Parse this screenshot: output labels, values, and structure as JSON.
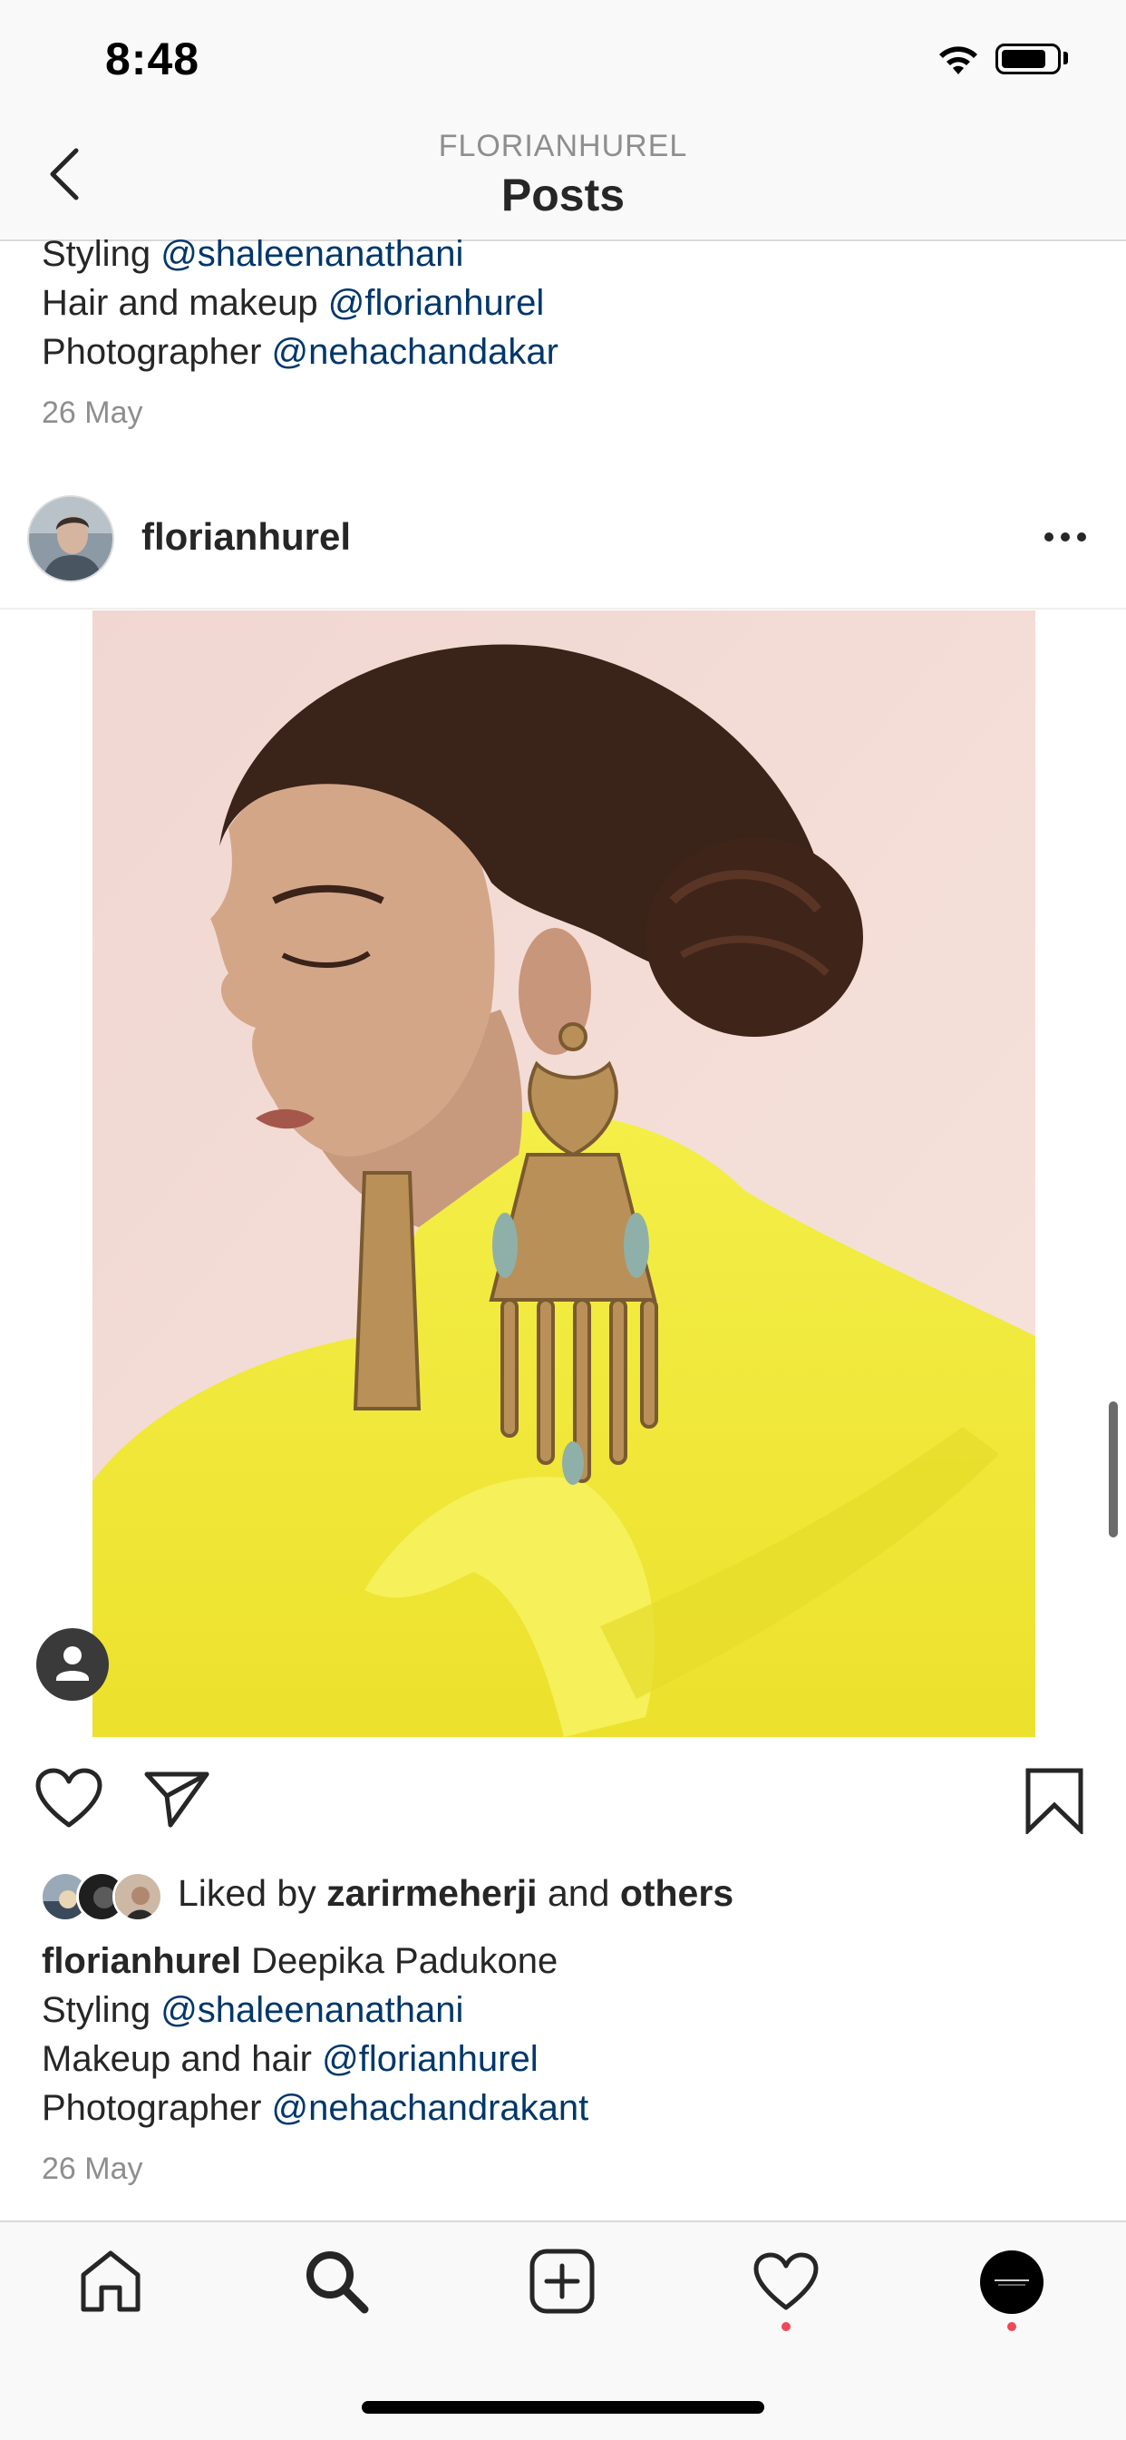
{
  "status": {
    "time": "8:48"
  },
  "header": {
    "account": "FLORIANHUREL",
    "title": "Posts"
  },
  "prev_post": {
    "lines": [
      {
        "label": "Styling",
        "mention": "@shaleenanathani"
      },
      {
        "label": "Hair and makeup",
        "mention": "@florianhurel"
      },
      {
        "label": "Photographer",
        "mention": "@nehachandakar"
      }
    ],
    "date": "26 May"
  },
  "post": {
    "username": "florianhurel",
    "likes": {
      "prefix": "Liked by",
      "user": "zarirmeherji",
      "and": "and",
      "others": "others"
    },
    "caption": {
      "user": "florianhurel",
      "text": "Deepika Padukone",
      "lines": [
        {
          "label": "Styling",
          "mention": "@shaleenanathani"
        },
        {
          "label": "Makeup and hair",
          "mention": "@florianhurel"
        },
        {
          "label": "Photographer",
          "mention": "@nehachandrakant"
        }
      ]
    },
    "date": "26 May"
  },
  "icons": {
    "back": "chevron-left-icon",
    "more": "more-horizontal-icon",
    "like": "heart-icon",
    "share": "paper-plane-icon",
    "save": "bookmark-icon",
    "tag": "person-tag-icon",
    "tabs": [
      "home-icon",
      "search-icon",
      "add-post-icon",
      "activity-heart-icon",
      "profile-avatar-icon"
    ]
  },
  "colors": {
    "mention": "#00376b",
    "notification_dot": "#ed4956",
    "photo_background": "#f3d9d3",
    "dress": "#f2ea3c"
  }
}
